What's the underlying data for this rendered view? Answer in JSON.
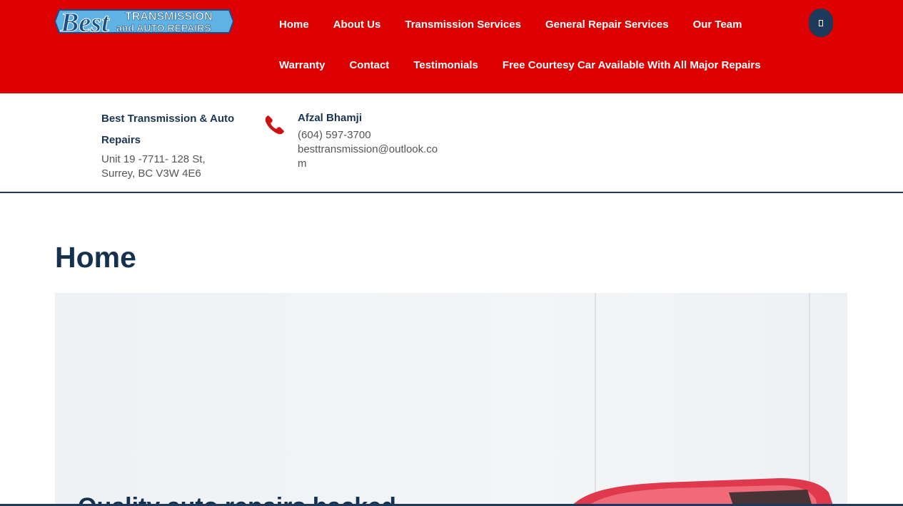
{
  "header": {
    "logo_top": "Best",
    "logo_right_line1": "TRANSMISSION",
    "logo_right_line2": "and AUTO REPAIRS",
    "nav_row1": [
      "Home",
      "About Us",
      "Transmission Services",
      "General Repair Services",
      "Our Team"
    ],
    "nav_row2": [
      "Warranty",
      "Contact",
      "Testimonials",
      "Free Courtesy Car Available With All Major Repairs"
    ],
    "search_icon": "search-icon"
  },
  "contact": {
    "business_name": "Best Transmission & Auto Repairs",
    "address_line1": "Unit 19 -7711- 128 St,",
    "address_line2": "Surrey, BC V3W 4E6",
    "phone_icon": "phone-icon",
    "person_name": "Afzal Bhamji",
    "phone": "(604) 597-3700",
    "email": "besttransmission@outlook.com"
  },
  "main": {
    "page_title": "Home",
    "hero_heading": "Quality auto repairs backed"
  },
  "colors": {
    "brand_red": "#dd0000",
    "navy": "#1d3a5a",
    "text_gray": "#555555"
  }
}
